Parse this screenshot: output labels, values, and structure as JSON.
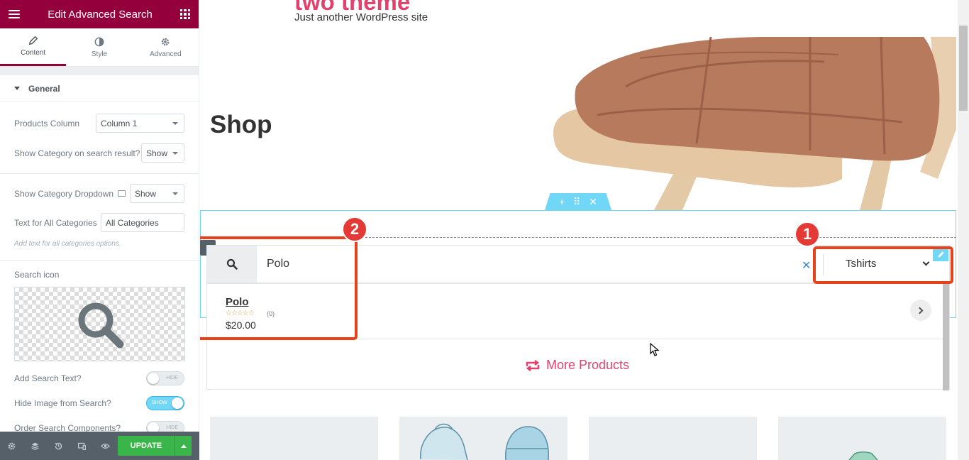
{
  "sidebar": {
    "title": "Edit Advanced Search",
    "tabs": [
      {
        "label": "Content"
      },
      {
        "label": "Style"
      },
      {
        "label": "Advanced"
      }
    ],
    "section_title": "General",
    "controls": {
      "products_column": {
        "label": "Products Column",
        "value": "Column 1"
      },
      "show_category_result": {
        "label": "Show Category on search result?",
        "value": "Show"
      },
      "show_category_dropdown": {
        "label": "Show Category Dropdown",
        "value": "Show"
      },
      "text_all_categories": {
        "label": "Text for All Categories",
        "value": "All Categories",
        "hint": "Add text for all categories options."
      },
      "search_icon": {
        "label": "Search icon"
      },
      "add_search_text": {
        "label": "Add Search Text?",
        "state": "HIDE"
      },
      "hide_image": {
        "label": "Hide Image from Search?",
        "state": "SHOW"
      },
      "order_components": {
        "label": "Order Search Components?",
        "state": "HIDE"
      }
    },
    "footer": {
      "update_label": "UPDATE"
    }
  },
  "site": {
    "title": "two theme",
    "tagline": "Just another WordPress site",
    "page_title": "Shop"
  },
  "search": {
    "query": "Polo",
    "category": "Tshirts",
    "clear_symbol": "✕",
    "result": {
      "name": "Polo",
      "stars": "☆☆☆☆☆",
      "reviews": "(0)",
      "price": "$20.00"
    },
    "more_products": "More Products"
  },
  "annotations": [
    {
      "number": "1"
    },
    {
      "number": "2"
    }
  ],
  "colors": {
    "brand": "#93003c",
    "accent": "#e2416d",
    "annotation": "#e8421c",
    "editor_handle": "#71d7f7",
    "update_button": "#39b54a"
  }
}
